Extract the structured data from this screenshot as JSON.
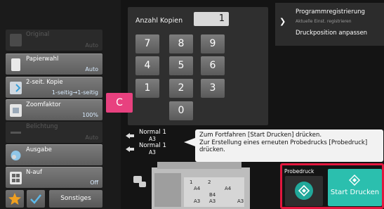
{
  "sidebar": {
    "items": [
      {
        "label": "Original",
        "value": "Auto",
        "enabled": false
      },
      {
        "label": "Papierwahl",
        "value": "Auto",
        "enabled": true
      },
      {
        "label": "2-seit. Kopie",
        "value": "1-seitig→1-seitig",
        "enabled": true
      },
      {
        "label": "Zoomfaktor",
        "value": "100%",
        "enabled": true
      },
      {
        "label": "Belichtung",
        "value": "Auto",
        "enabled": false
      },
      {
        "label": "Ausgabe",
        "value": "",
        "enabled": true
      },
      {
        "label": "N-auf",
        "value": "Off",
        "enabled": true
      }
    ],
    "other_label": "Sonstiges"
  },
  "copies": {
    "label": "Anzahl Kopien",
    "value": "1"
  },
  "keypad": {
    "keys": [
      "7",
      "8",
      "9",
      "4",
      "5",
      "6",
      "1",
      "2",
      "3",
      "0"
    ],
    "clear": "C"
  },
  "menu": {
    "item1": "Programmregistrierung",
    "item1_sub": "Aktuelle Einst. registrieren",
    "item2": "Druckposition anpassen"
  },
  "preview": {
    "papers": [
      {
        "name": "Normal 1",
        "size": "A3"
      },
      {
        "name": "Normal 1",
        "size": "A3"
      }
    ],
    "trays": [
      "1",
      "2",
      "A4",
      "A4",
      "B4",
      "A3",
      "A3",
      "A3"
    ]
  },
  "tooltip": {
    "line1": "Zum Fortfahren [Start Drucken] drücken.",
    "line2": "Zur Erstellung eines erneuten Probedrucks [Probedruck]",
    "line3": "drücken."
  },
  "start": {
    "proof_label": "Probedruck",
    "start_label": "Start Drucken"
  },
  "colors": {
    "accent_teal": "#2bbfae",
    "clear_key": "#e8417f",
    "highlight_frame": "#e3173e"
  }
}
